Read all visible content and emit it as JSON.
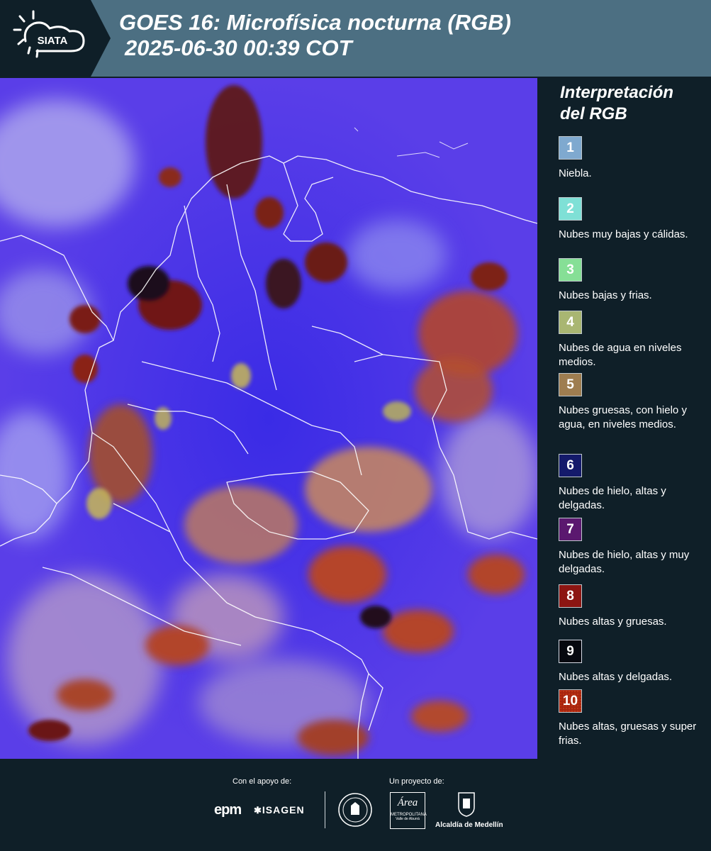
{
  "header": {
    "logo_text": "SIATA",
    "title_line1": "GOES 16: Microfísica nocturna (RGB)",
    "title_line2": "2025-06-30 00:39 COT"
  },
  "legend": {
    "title_line1": "Interpretación",
    "title_line2": "del RGB",
    "items": [
      {
        "num": "1",
        "label": "Niebla.",
        "color": "#7fa9cf"
      },
      {
        "num": "2",
        "label": "Nubes muy bajas y cálidas.",
        "color": "#7fe0d6"
      },
      {
        "num": "3",
        "label": "Nubes bajas y frias.",
        "color": "#86df96"
      },
      {
        "num": "4",
        "label": "Nubes de agua en niveles medios.",
        "color": "#a9b672"
      },
      {
        "num": "5",
        "label": "Nubes gruesas, con hielo y agua, en niveles medios.",
        "color": "#9e7d50"
      },
      {
        "num": "6",
        "label": "Nubes de hielo, altas y delgadas.",
        "color": "#141a6b"
      },
      {
        "num": "7",
        "label": "Nubes de hielo, altas y muy delgadas.",
        "color": "#5b186f"
      },
      {
        "num": "8",
        "label": "Nubes altas y gruesas.",
        "color": "#8c1512"
      },
      {
        "num": "9",
        "label": "Nubes altas y delgadas.",
        "color": "#06080f"
      },
      {
        "num": "10",
        "label": "Nubes altas, gruesas y super frias.",
        "color": "#a8250f"
      }
    ]
  },
  "footer": {
    "support_label": "Con el apoyo de:",
    "project_label": "Un proyecto de:",
    "logos": {
      "epm": "epm",
      "isagen": "ISAGEN",
      "area_line1": "Área",
      "area_line2": "METROPOLITANA",
      "area_line3": "Valle de Aburrá",
      "alcaldia": "Alcaldía de Medellín"
    }
  }
}
